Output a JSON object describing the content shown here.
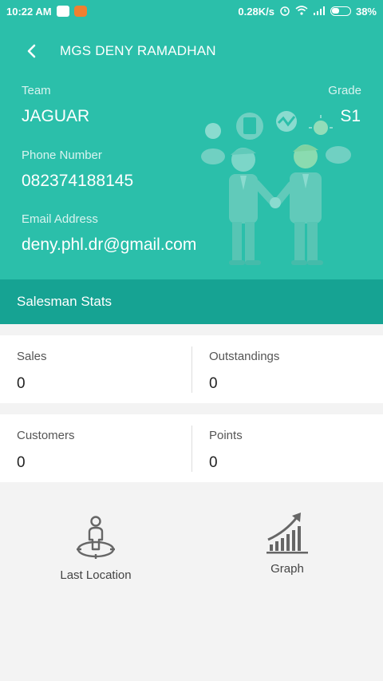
{
  "status_bar": {
    "time": "10:22 AM",
    "speed": "0.28K/s",
    "battery": "38%",
    "icons": [
      "bbm-icon",
      "app-icon",
      "alarm-icon",
      "wifi-icon",
      "signal-icon",
      "battery-icon"
    ]
  },
  "header": {
    "title": "MGS DENY RAMADHAN",
    "team_label": "Team",
    "team_value": "JAGUAR",
    "grade_label": "Grade",
    "grade_value": "S1",
    "phone_label": "Phone Number",
    "phone_value": "082374188145",
    "email_label": "Email Address",
    "email_value": "deny.phl.dr@gmail.com"
  },
  "section": {
    "title": "Salesman Stats"
  },
  "stats": {
    "sales_label": "Sales",
    "sales_value": "0",
    "outstandings_label": "Outstandings",
    "outstandings_value": "0",
    "customers_label": "Customers",
    "customers_value": "0",
    "points_label": "Points",
    "points_value": "0"
  },
  "actions": {
    "last_location_label": "Last Location",
    "graph_label": "Graph"
  },
  "colors": {
    "header_bg": "#2bbfaa",
    "section_bg": "#16a393",
    "page_bg": "#f3f3f3"
  }
}
